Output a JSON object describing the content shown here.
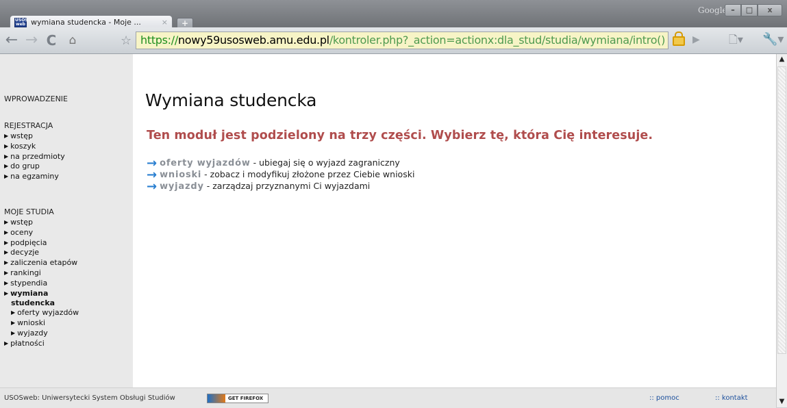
{
  "browser": {
    "tab_title": "wymiana studencka - Moje ...",
    "tab_close": "×",
    "new_tab": "+",
    "google_label": "Google",
    "favicon_text": "USOS web",
    "win_min": "–",
    "win_max": "□",
    "win_close": "x",
    "url_scheme": "https://",
    "url_host": "nowy59usosweb.amu.edu.pl",
    "url_path": "/kontroler.php?_action=actionx:dla_stud/studia/wymiana/intro()",
    "icons": {
      "back": "←",
      "forward": "→",
      "reload": "C",
      "home": "⌂",
      "star": "☆",
      "play": "▶",
      "page": "🗋▾",
      "wrench": "🔧▾"
    }
  },
  "sidebar": {
    "intro": "WPROWADZENIE",
    "registration": {
      "heading": "REJESTRACJA",
      "items": [
        "wstęp",
        "koszyk",
        "na przedmioty",
        "do grup",
        "na egzaminy"
      ]
    },
    "studies": {
      "heading": "MOJE STUDIA",
      "items": [
        "wstęp",
        "oceny",
        "podpięcia",
        "decyzje",
        "zaliczenia etapów",
        "rankingi",
        "stypendia"
      ],
      "active": "wymiana",
      "active_cont": "studencka",
      "subitems": [
        "oferty wyjazdów",
        "wnioski",
        "wyjazdy"
      ],
      "last": "płatności"
    }
  },
  "main": {
    "title": "Wymiana studencka",
    "lead": "Ten moduł jest podzielony na trzy części. Wybierz tę, która Cię interesuje.",
    "options": [
      {
        "link": "oferty wyjazdów",
        "desc": " - ubiegaj się o wyjazd zagraniczny"
      },
      {
        "link": "wnioski",
        "desc": " - zobacz i modyfikuj złożone przez Ciebie wnioski"
      },
      {
        "link": "wyjazdy",
        "desc": " - zarządzaj przyznanymi Ci wyjazdami"
      }
    ]
  },
  "footer": {
    "text": "USOSweb: Uniwersytecki System Obsługi Studiów",
    "badge": "GET FIREFOX",
    "help": ":: pomoc",
    "contact": ":: kontakt"
  },
  "colors": {
    "lead": "#b04d4d",
    "arrow": "#2a7fd0",
    "link": "#8a8f96",
    "omnibox": "#f7f4c6"
  }
}
